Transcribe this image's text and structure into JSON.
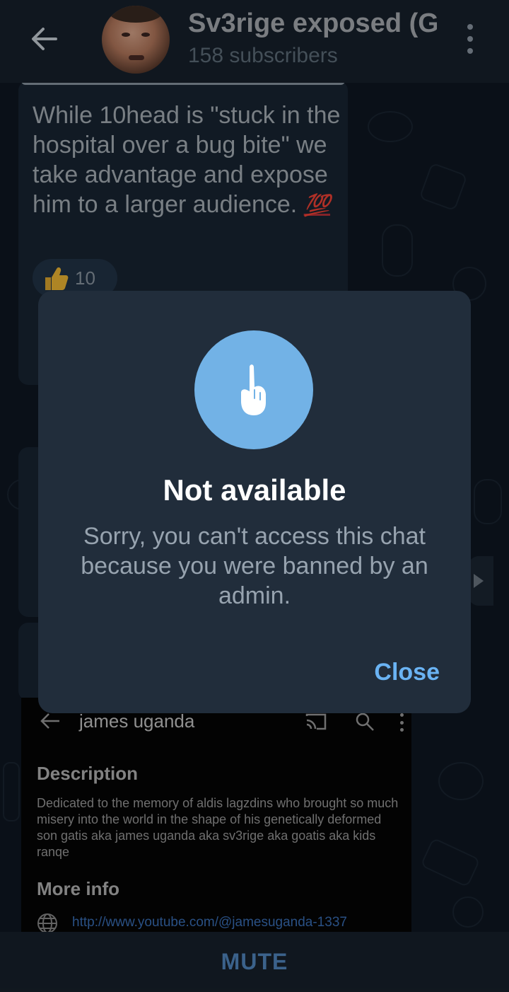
{
  "header": {
    "title": "Sv3rige exposed (G",
    "subscribers": "158 subscribers"
  },
  "message": {
    "text": "While 10head is \"stuck in the hospital over a bug bite\" we take advantage and expose him to a larger audience.",
    "emoji": "💯",
    "reaction_emoji": "thumbs-up",
    "reaction_count": "10"
  },
  "embedded_screenshot": {
    "title": "james uganda",
    "description_heading": "Description",
    "description_text": "Dedicated to the memory of aldis lagzdins who brought so much misery into the world in the shape of his genetically deformed son gatis aka james uganda aka sv3rige aka goatis aka kids ranqe",
    "more_info_heading": "More info",
    "link": "http://www.youtube.com/@jamesuganda-1337"
  },
  "dialog": {
    "icon": "raised-finger-icon",
    "title": "Not available",
    "text": "Sorry, you can't access this chat because you were banned by an admin.",
    "close_label": "Close"
  },
  "bottom_bar": {
    "mute_label": "MUTE"
  },
  "colors": {
    "accent": "#6ab3f3",
    "icon_circle": "#72b2e6",
    "dialog_bg": "#212d3b",
    "header_bg": "#17212b",
    "chat_bg": "#0e1621"
  }
}
